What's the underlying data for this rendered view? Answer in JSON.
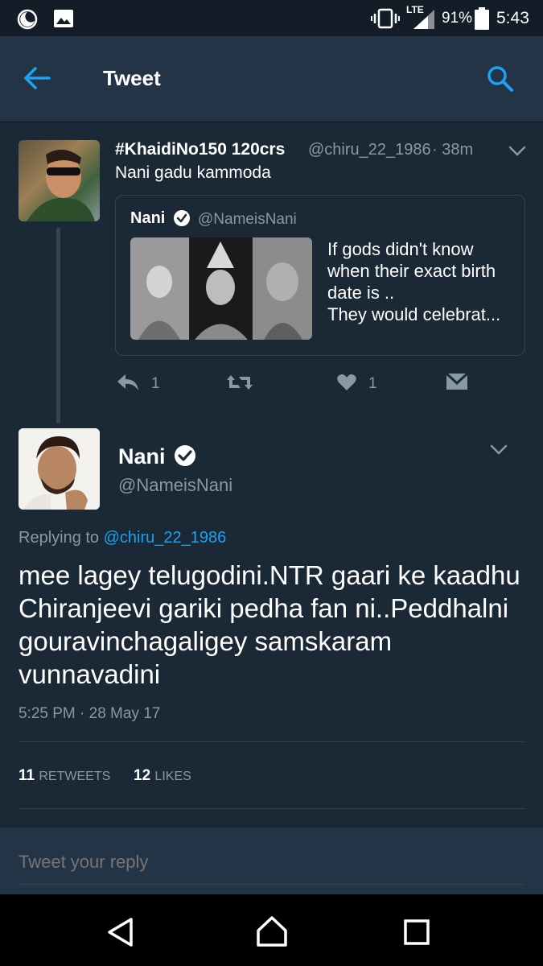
{
  "status_bar": {
    "network": "LTE",
    "battery_percent": "91%",
    "time": "5:43",
    "icons": [
      "moon-icon",
      "image-icon",
      "vibrate-icon",
      "signal-icon",
      "battery-icon"
    ]
  },
  "app_bar": {
    "title": "Tweet",
    "back_icon": "back-arrow-icon",
    "search_icon": "search-icon"
  },
  "parent_tweet": {
    "display_name": "#KhaidiNo150 120crs",
    "handle": "@chiru_22_1986",
    "time_ago": "· 38m",
    "text": "Nani gadu kammoda",
    "quoted": {
      "display_name": "Nani",
      "handle": "@NameisNani",
      "text": "If gods didn't know when their exact birth date is ..\nThey would celebrat..."
    },
    "actions": {
      "reply_count": "1",
      "like_count": "1"
    }
  },
  "main_tweet": {
    "display_name": "Nani",
    "handle": "@NameisNani",
    "replying_prefix": "Replying to ",
    "replying_handle": "@chiru_22_1986",
    "text": "mee lagey telugodini.NTR gaari ke kaadhu Chiranjeevi gariki pedha fan ni..Peddhalni gouravinchagaligey samskaram vunnavadini",
    "timestamp": "5:25 PM · 28 May 17",
    "retweets_count": "11",
    "retweets_label": "RETWEETS",
    "likes_count": "12",
    "likes_label": "LIKES"
  },
  "reply_box": {
    "placeholder": "Tweet your reply"
  },
  "colors": {
    "accent": "#1da1f2",
    "background": "#1b2836",
    "header": "#243447",
    "muted": "#8899a6"
  }
}
